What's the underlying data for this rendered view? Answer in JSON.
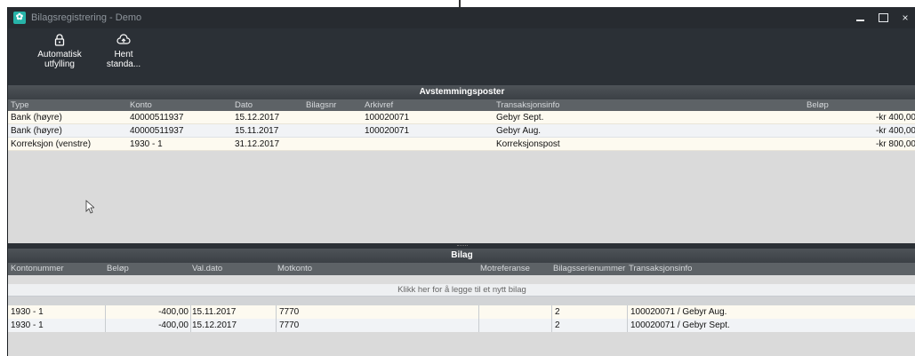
{
  "window": {
    "title": "Bilagsregistrering - Demo",
    "app_icon": "app-logo-icon",
    "minimize": "minimize-icon",
    "maximize": "maximize-icon",
    "close_glyph": "×"
  },
  "ribbon": {
    "buttons": [
      {
        "line1": "Automatisk",
        "line2": "utfylling",
        "icon": "lock-icon"
      },
      {
        "line1": "Hent",
        "line2": "standa...",
        "icon": "cloud-upload-icon"
      }
    ]
  },
  "avstemming": {
    "title": "Avstemmingsposter",
    "columns": [
      "Type",
      "Konto",
      "Dato",
      "Bilagsnr",
      "Arkivref",
      "Transaksjonsinfo",
      "Beløp"
    ],
    "rows": [
      {
        "type": "Bank (høyre)",
        "konto": "40000511937",
        "dato": "15.12.2017",
        "bilagsnr": "",
        "arkivref": "100020071",
        "info": "Gebyr Sept.",
        "belop": "-kr 400,00"
      },
      {
        "type": "Bank (høyre)",
        "konto": "40000511937",
        "dato": "15.11.2017",
        "bilagsnr": "",
        "arkivref": "100020071",
        "info": "Gebyr Aug.",
        "belop": "-kr 400,00"
      },
      {
        "type": "Korreksjon (venstre)",
        "konto": "1930 - 1",
        "dato": "31.12.2017",
        "bilagsnr": "",
        "arkivref": "",
        "info": "Korreksjonspost",
        "belop": "-kr 800,00"
      }
    ]
  },
  "bilag": {
    "title": "Bilag",
    "columns": [
      "Kontonummer",
      "Beløp",
      "Val.dato",
      "Motkonto",
      "Motreferanse",
      "Bilagsserienummer",
      "Transaksjonsinfo"
    ],
    "add_row_text": "Klikk her for å legge til et nytt bilag",
    "rows": [
      {
        "konto": "1930 - 1",
        "belop": "-400,00",
        "valdato": "15.11.2017",
        "motkonto": "7770",
        "motref": "",
        "serie": "2",
        "info": "100020071 / Gebyr Aug."
      },
      {
        "konto": "1930 - 1",
        "belop": "-400,00",
        "valdato": "15.12.2017",
        "motkonto": "7770",
        "motref": "",
        "serie": "2",
        "info": "100020071 / Gebyr Sept."
      }
    ]
  }
}
